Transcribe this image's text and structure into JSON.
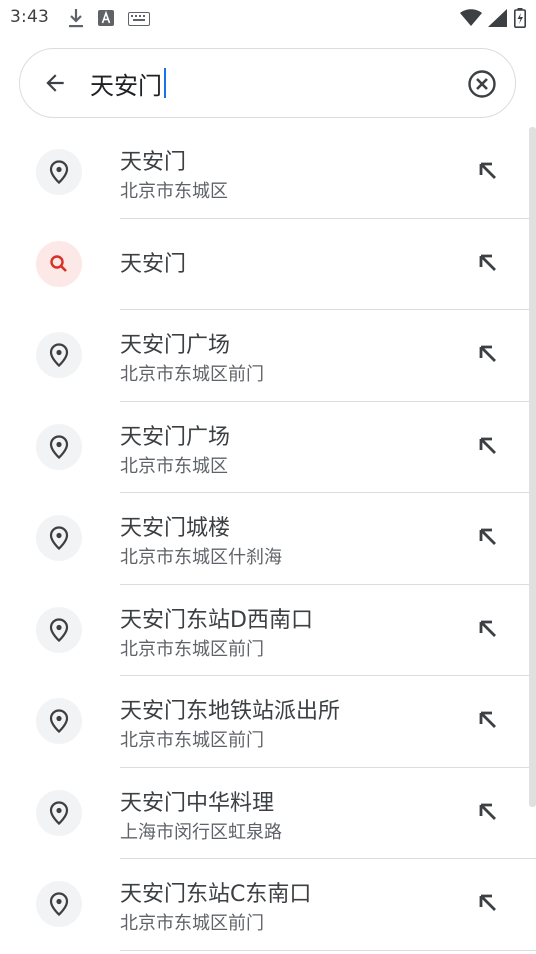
{
  "status": {
    "time": "3:43",
    "icons_left": [
      "download-icon",
      "keyboard-a-icon",
      "keyboard-icon"
    ],
    "icons_right": [
      "wifi-icon",
      "signal-icon",
      "battery-icon"
    ]
  },
  "search": {
    "query": "天安门"
  },
  "results": [
    {
      "title": "天安门",
      "subtitle": "北京市东城区",
      "type": "place"
    },
    {
      "title": "天安门",
      "subtitle": "",
      "type": "search"
    },
    {
      "title": "天安门广场",
      "subtitle": "北京市东城区前门",
      "type": "place"
    },
    {
      "title": "天安门广场",
      "subtitle": "北京市东城区",
      "type": "place"
    },
    {
      "title": "天安门城楼",
      "subtitle": "北京市东城区什刹海",
      "type": "place"
    },
    {
      "title": "天安门东站D西南口",
      "subtitle": "北京市东城区前门",
      "type": "place"
    },
    {
      "title": "天安门东地铁站派出所",
      "subtitle": "北京市东城区前门",
      "type": "place"
    },
    {
      "title": "天安门中华料理",
      "subtitle": "上海市闵行区虹泉路",
      "type": "place"
    },
    {
      "title": "天安门东站C东南口",
      "subtitle": "北京市东城区前门",
      "type": "place"
    }
  ],
  "colors": {
    "place_icon_bg": "#f1f3f4",
    "search_icon_bg": "#fce8e6",
    "search_icon": "#d93025",
    "accent": "#1a73e8"
  }
}
